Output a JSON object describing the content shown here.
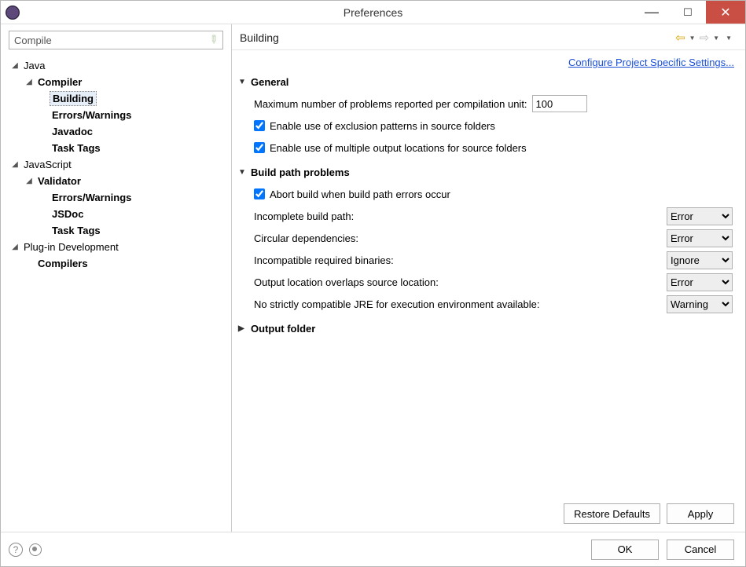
{
  "window": {
    "title": "Preferences"
  },
  "search": {
    "value": "Compile"
  },
  "tree": {
    "items": [
      {
        "label": "Java",
        "indent": 1,
        "expand": "open",
        "bold": false,
        "selected": false
      },
      {
        "label": "Compiler",
        "indent": 2,
        "expand": "open",
        "bold": true,
        "selected": false
      },
      {
        "label": "Building",
        "indent": 3,
        "expand": "none",
        "bold": true,
        "selected": true
      },
      {
        "label": "Errors/Warnings",
        "indent": 3,
        "expand": "none",
        "bold": true,
        "selected": false
      },
      {
        "label": "Javadoc",
        "indent": 3,
        "expand": "none",
        "bold": true,
        "selected": false
      },
      {
        "label": "Task Tags",
        "indent": 3,
        "expand": "none",
        "bold": true,
        "selected": false
      },
      {
        "label": "JavaScript",
        "indent": 1,
        "expand": "open",
        "bold": false,
        "selected": false
      },
      {
        "label": "Validator",
        "indent": 2,
        "expand": "open",
        "bold": true,
        "selected": false
      },
      {
        "label": "Errors/Warnings",
        "indent": 3,
        "expand": "none",
        "bold": true,
        "selected": false
      },
      {
        "label": "JSDoc",
        "indent": 3,
        "expand": "none",
        "bold": true,
        "selected": false
      },
      {
        "label": "Task Tags",
        "indent": 3,
        "expand": "none",
        "bold": true,
        "selected": false
      },
      {
        "label": "Plug-in Development",
        "indent": 1,
        "expand": "open",
        "bold": false,
        "selected": false
      },
      {
        "label": "Compilers",
        "indent": 2,
        "expand": "none",
        "bold": true,
        "selected": false
      }
    ]
  },
  "panel": {
    "title": "Building",
    "config_link": "Configure Project Specific Settings..."
  },
  "sections": {
    "general": {
      "title": "General",
      "max_problems_label": "Maximum number of problems reported per compilation unit:",
      "max_problems_value": "100",
      "exclusion_label": "Enable use of exclusion patterns in source folders",
      "exclusion_checked": true,
      "multi_output_label": "Enable use of multiple output locations for source folders",
      "multi_output_checked": true
    },
    "build_path": {
      "title": "Build path problems",
      "abort_label": "Abort build when build path errors occur",
      "abort_checked": true,
      "rows": [
        {
          "label": "Incomplete build path:",
          "value": "Error"
        },
        {
          "label": "Circular dependencies:",
          "value": "Error"
        },
        {
          "label": "Incompatible required binaries:",
          "value": "Ignore"
        },
        {
          "label": "Output location overlaps source location:",
          "value": "Error"
        },
        {
          "label": "No strictly compatible JRE for execution environment available:",
          "value": "Warning"
        }
      ]
    },
    "output_folder": {
      "title": "Output folder"
    }
  },
  "select_options": [
    "Error",
    "Warning",
    "Ignore"
  ],
  "buttons": {
    "restore_defaults": "Restore Defaults",
    "apply": "Apply",
    "ok": "OK",
    "cancel": "Cancel"
  }
}
